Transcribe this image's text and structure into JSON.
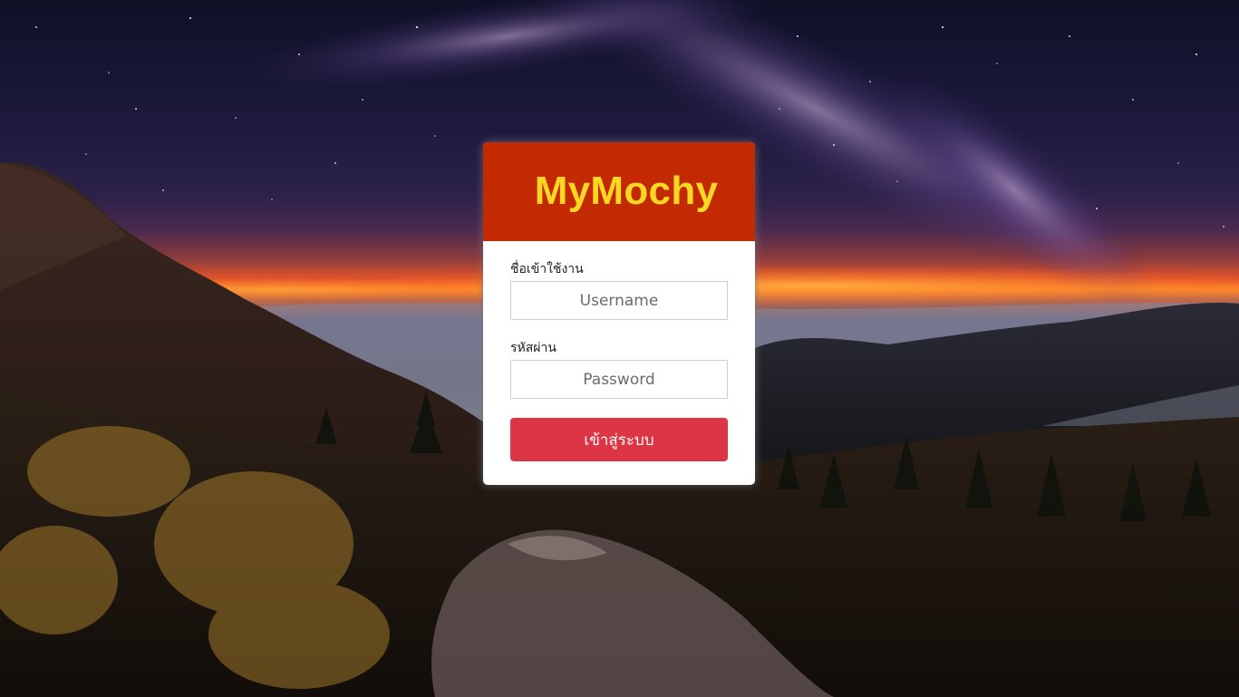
{
  "brand": {
    "name": "MyMochy",
    "header_color": "#c42a02",
    "text_color": "#fad723"
  },
  "login": {
    "username_label": "ชื่อเข้าใช้งาน",
    "username_placeholder": "Username",
    "password_label": "รหัสผ่าน",
    "password_placeholder": "Password",
    "submit_label": "เข้าสู่ระบบ",
    "submit_color": "#dc3545"
  },
  "background": {
    "description": "night-sky-milky-way-mountain-photo"
  }
}
